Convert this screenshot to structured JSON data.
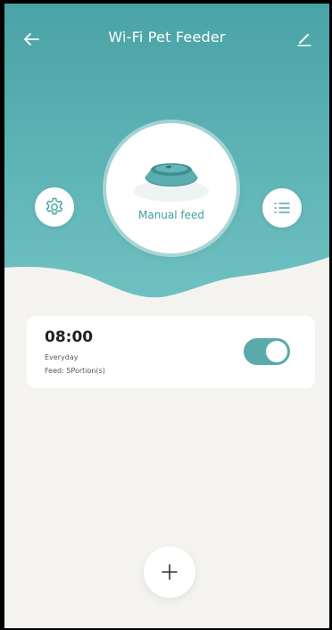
{
  "header": {
    "title": "Wi-Fi Pet Feeder"
  },
  "hero": {
    "manual_feed_label": "Manual feed"
  },
  "schedules": [
    {
      "time": "08:00",
      "repeat": "Everyday",
      "feed": "Feed: 5Portion(s)",
      "enabled": true
    }
  ],
  "colors": {
    "accent": "#5aa9ab",
    "hero_top": "#4fa7aa",
    "hero_bottom": "#6bbfc0",
    "background": "#f4f3ef"
  },
  "icons": {
    "back": "arrow-left-icon",
    "edit": "pencil-icon",
    "settings": "gear-icon",
    "list": "list-icon",
    "bowl": "pet-bowl-icon",
    "add": "plus-icon"
  }
}
